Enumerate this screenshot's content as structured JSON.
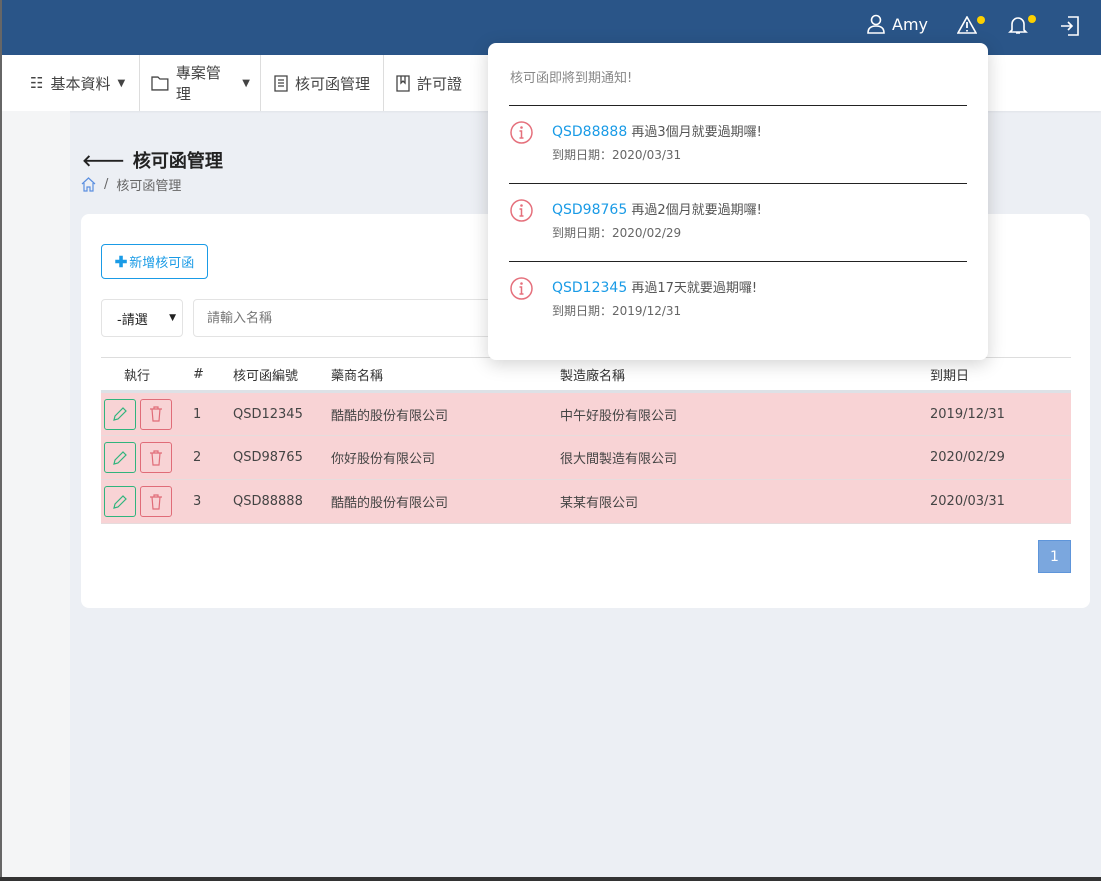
{
  "topbar": {
    "user": "Amy"
  },
  "nav": {
    "items": [
      {
        "label": "基本資料",
        "dropdown": true
      },
      {
        "label": "專案管理",
        "dropdown": true
      },
      {
        "label": "核可函管理"
      },
      {
        "label": "許可證"
      }
    ]
  },
  "page": {
    "title": "核可函管理",
    "breadcrumb": "核可函管理"
  },
  "toolbar": {
    "add_label": "新增核可函",
    "select_value": "-請選",
    "search_placeholder": "請輸入名稱"
  },
  "table": {
    "headers": [
      "執行",
      "#",
      "核可函編號",
      "藥商名稱",
      "製造廠名稱",
      "到期日"
    ],
    "rows": [
      {
        "no": "1",
        "code": "QSD12345",
        "pharma": "酷酷的股份有限公司",
        "maker": "中午好股份有限公司",
        "expiry": "2019/12/31"
      },
      {
        "no": "2",
        "code": "QSD98765",
        "pharma": "你好股份有限公司",
        "maker": "很大間製造有限公司",
        "expiry": "2020/02/29"
      },
      {
        "no": "3",
        "code": "QSD88888",
        "pharma": "酷酷的股份有限公司",
        "maker": "某某有限公司",
        "expiry": "2020/03/31"
      }
    ]
  },
  "pagination": {
    "current": "1"
  },
  "popup": {
    "title": "核可函即將到期通知!",
    "items": [
      {
        "code": "QSD88888",
        "message": "再過3個月就要過期囉!",
        "date": "到期日期：2020/03/31"
      },
      {
        "code": "QSD98765",
        "message": "再過2個月就要過期囉!",
        "date": "到期日期：2020/02/29"
      },
      {
        "code": "QSD12345",
        "message": "再過17天就要過期囉!",
        "date": "到期日期：2019/12/31"
      }
    ]
  },
  "colors": {
    "header": "#2a5588",
    "accent": "#1a9be6",
    "row_warning": "#f8d3d5",
    "badge": "#fcd000"
  }
}
